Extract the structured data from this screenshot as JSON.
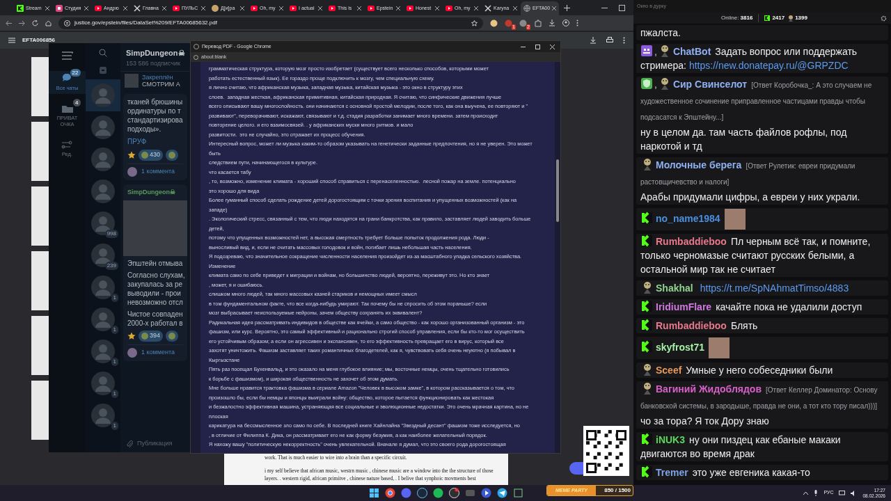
{
  "browser": {
    "tabs": [
      {
        "label": "Stream",
        "kind": "kick",
        "selected": false
      },
      {
        "label": "Студия",
        "kind": "studio",
        "selected": false
      },
      {
        "label": "Андрю",
        "kind": "youtube",
        "selected": false
      },
      {
        "label": "Главна",
        "kind": "x",
        "selected": false
      },
      {
        "label": "ПУЛЬС",
        "kind": "youtube",
        "selected": false
      },
      {
        "label": "Д[и]ра",
        "kind": "avatar",
        "selected": false
      },
      {
        "label": "Oh, my",
        "kind": "youtube",
        "selected": false
      },
      {
        "label": "I actual",
        "kind": "youtube",
        "selected": false
      },
      {
        "label": "This is",
        "kind": "youtube",
        "selected": false
      },
      {
        "label": "Epstein",
        "kind": "youtube",
        "selected": false
      },
      {
        "label": "Honest",
        "kind": "youtube",
        "selected": false
      },
      {
        "label": "Oh, my",
        "kind": "youtube",
        "selected": false
      },
      {
        "label": "Karyna",
        "kind": "x",
        "selected": false
      },
      {
        "label": "EFTA00",
        "kind": "globe",
        "selected": true
      }
    ],
    "url": "justice.gov/epstein/files/DataSet%209/EFTA00685632.pdf",
    "extensions": [
      {
        "kind": "coin"
      },
      {
        "kind": "red",
        "badge": "1"
      },
      {
        "kind": "box",
        "badge": "2"
      },
      {
        "kind": "puzzle"
      }
    ],
    "pdf_title": "EFTA006856",
    "pdf_page": [
      [
        "work. That is much easier to wire into a brain than a specific circuit."
      ],
      [
        "i my self  believe that african music, westrn music , chinese music  are a window into the the structure of those",
        "layers.  .   western rigid,  african primitve , chinese nature based, .    I belive that synphoic movments best"
      ]
    ]
  },
  "telegram": {
    "folders": [
      {
        "label": "Все чаты",
        "badge": "22",
        "kind": "chats",
        "selected": true
      },
      {
        "label": "ПРИВАТ ОЧКА",
        "badge": "4",
        "kind": "folder",
        "selected": false
      },
      {
        "label": "Ред.",
        "kind": "edit",
        "selected": false
      }
    ],
    "chats": [
      {
        "selected": true
      },
      {
        "selected": false
      },
      {
        "selected": false
      },
      {
        "selected": false
      },
      {
        "badge": "998",
        "selected": false
      },
      {
        "badge": "239",
        "selected": false
      },
      {
        "badge": "1",
        "selected": false
      },
      {
        "badge": "1",
        "selected": false
      },
      {
        "badge": "1",
        "selected": false
      },
      {
        "badge": "1",
        "selected": false
      },
      {
        "badge": "1",
        "selected": false
      }
    ],
    "channel": {
      "title": "SimpDungeon☠",
      "subscribers": "153 586 подписчик"
    },
    "pinned": {
      "label": "Закреплён",
      "text": "СМОТРИМ А"
    },
    "posts": [
      {
        "paragraphs": [
          [
            "тканей брюшины",
            "ординатуры по т",
            "стандартизирова",
            "подходы»."
          ]
        ],
        "link": "ПРУФ",
        "reactions": [
          {
            "kind": "star"
          },
          {
            "kind": "emoji",
            "count": "430"
          },
          {
            "kind": "emoji"
          }
        ],
        "comments": "1 коммента"
      },
      {
        "author": "SimpDungeon☠",
        "media": true,
        "paragraphs": [
          [
            "Эпштейн отмыва"
          ],
          [
            "Согласно слухам,",
            "закупалась за ре",
            "выводили - прои",
            "невозможно отсл"
          ],
          [
            "Чистое совпаден",
            "2000-х работал в"
          ]
        ],
        "reactions": [
          {
            "kind": "star"
          },
          {
            "kind": "emoji",
            "count": "394"
          },
          {
            "kind": "emoji"
          }
        ],
        "comments": "1 коммента"
      }
    ],
    "composer": {
      "placeholder": "Публикация"
    }
  },
  "translator": {
    "title": "Перевод PDF - Google Chrome",
    "url": "about:blank",
    "lines": [
      "грамматическая структура, которую мозг просто изобретает (существует всего несколько способов, которыми может",
      "работать естественный язык). Ее гораздо проще подключить к мозгу, чем специальную схему.",
      "я лично считаю, что африканская музыка, западная музыка, китайская музыка - это окно в структуру этих",
      "слоев.  западная жесткая, африканская примитивная, китайская природная. Я считаю, что синфические движения лучше",
      "всего описывают вашу многослойность. они начинаются с основной простой мелодии, после того, как она выучена, ее повторяют и \"",
      "развивают\", переворачивают, искажают, связывают и т.д. стадия разработки занимает много времени. затем происходит",
      "повторение целого. и его взаимосвязей. . у африканских муски много ритмов. и мало",
      "развитости.  это не случайно, это отражает их процесс обучения.",
      "Интересный вопрос, может ли музыка каким-то образом указывать на генетически заданные предпочтения, но я не уверен. Это может",
      "быть",
      "следствием пути, начинающегося в культуре.",
      "что касается табу",
      ", то, возможно, изменение климата - хороший способ справиться с перенаселенностью.  лесной пожар на земле. потенциально",
      "это хорошо для вида",
      "Более гуманный способ сделать рождение детей дорогостоящим с точки зрения воспитания и упущенных возможностей (как на",
      "западе)",
      ". Экологический стресс, связанный с тем, что люди находятся на грани банкротства, как правило, заставляет людей заводить больше",
      "детей,",
      "потому что упущенных возможностей нет, а высокая смертность требует больше попыток продолжения рода. Люди -",
      "выносливый вид, и, если не считать массовых голодовок и войн, погибает лишь небольшая часть населения.",
      "Я подозреваю, что значительное сокращение численности населения произойдет из-за масштабного упадка сельского хозяйства.",
      "Изменение",
      "климата само по себе приведет к миграции и войнам, но большинство людей, вероятно, переживут это. Но кто знает",
      ", может, я и ошибаюсь.",
      "слишком много людей, так много массовых казней стариков и немощных имеет смысл",
      "в том фундаментальном факте, что все когда-нибудь умирают. Так почему бы не спросить об этом пораньше? если",
      "мозг выбрасывает неиспользуемые нейроны, зачем обществу сохранять их эквивалент?",
      "Радикальная идея рассматривать индивидов в обществе как ячейки, а само общество - как хорошо организованный организм - это",
      "фашизм, или курс. Вероятно, это самый эффективный и рационально строгий способ управления, если бы кто-то мог осуществить",
      "его устойчивым образом; а если он агрессивен и экспансивен, то его эффективность превращает его в вирус, который все",
      "захотят уничтожить. Фашизм заставляет таких романтичных благодетелей, как я, чувствовать себя очень неуютно (я побывал в",
      "Кыргызстане",
      "Пять раз посещал Бухенвальд, и это оказало на меня глубокое влияние; мы, восточные немцы, очень тщательно готовились",
      "к борьбе с фашизмом), и широкая общественность не захочет об этом думать.",
      "Мне больше нравится трактовка фашизма в сериале Amazon \"Человек в высоком замке\", в котором рассказывается о том, что",
      "произошло бы, если бы немцы и японцы выиграли войну: общество, которое пытается функционировать как жестокая",
      "и безжалостно эффективная машина, устраняющая все социальные и эволюционные недостатки. Это очень мрачная картина, но не",
      "плоская",
      "карикатура на бессмысленное зло само по себе. В последней книге Хайнлайна \"Звездный десант\" фашизм тоже исследуется, но",
      ", в отличие от Филиппа К. Дика, он рассматривает его не как форму безумия, а как наиболее желательный порядок.",
      "Я нахожу вашу \"политическую некорректность\" очень увлекательной. Вначале я думал, что это своего рода дорогостоящая"
    ]
  },
  "chat": {
    "window_title": "Окно в дурку",
    "online_label": "Online:",
    "online": "3816",
    "followers": "2417",
    "mascots": "1399",
    "badge_separator": ",",
    "messages": [
      {
        "text": "пжалста."
      },
      {
        "badges": [
          {
            "kind": "bot"
          },
          {
            "kind": "mascot"
          }
        ],
        "name": "ChatBot",
        "color": "#8fb1f2",
        "text": "Задать вопрос или поддержать стримера:",
        "link": "https://new.donatepay.ru/@GRPZDC"
      },
      {
        "badges": [
          {
            "kind": "shield"
          },
          {
            "kind": "mascot"
          }
        ],
        "name": "Сир Свинселот",
        "color": "#8fb1f2",
        "reply": "[Ответ Коробочка_: А это случаем не художественное сочинение приправленное частицами правды чтобы подсасатся к Эпштейну...]",
        "text": "ну в целом да. там часть файлов рофлы, под наркотой и тд"
      },
      {
        "badges": [
          {
            "kind": "mascot"
          }
        ],
        "name": "Молочные берега",
        "color": "#8fb1f2",
        "reply": "[Ответ Рулетик: евреи придумали растовщичевство и налоги]",
        "text": "Арабы придумали цифры, а евреи у них украли."
      },
      {
        "badges": [
          {
            "kind": "kick"
          }
        ],
        "name": "no_name1984",
        "color": "#4a8fe0",
        "emote": true
      },
      {
        "badges": [
          {
            "kind": "kick"
          }
        ],
        "name": "Rumbaddieboo",
        "color": "#e8788a",
        "text": "Пл черным всё так, и помните, только черномазые считают русских белыми, а остальной мир так не считает"
      },
      {
        "badges": [
          {
            "kind": "mascot"
          }
        ],
        "name": "Shakhal",
        "color": "#8fd48f",
        "link": "https://t.me/SpNAhmatTimso/4883"
      },
      {
        "badges": [
          {
            "kind": "kick"
          }
        ],
        "name": "IridiumFlare",
        "color": "#d078e0",
        "text": "качайте пока не удалили доступ"
      },
      {
        "badges": [
          {
            "kind": "kick"
          }
        ],
        "name": "Rumbaddieboo",
        "color": "#e8788a",
        "text": "Блять"
      },
      {
        "badges": [
          {
            "kind": "kick"
          }
        ],
        "name": "skyfrost71",
        "color": "#a8f0a8",
        "emote": true
      },
      {
        "badges": [
          {
            "kind": "mascot"
          }
        ],
        "name": "Sceef",
        "color": "#e8985a",
        "text": "Умные у него собеседники были"
      },
      {
        "badges": [
          {
            "kind": "mascot"
          }
        ],
        "name": "Вагиний Жидоблядов",
        "color": "#d860c8",
        "reply": "[Ответ Келлер Доминатор: Основу банковской системы, в зародыше, правда не они, а тот кто тору писал)))]",
        "text": "чо за тора? Я ток Дору знаю"
      },
      {
        "badges": [
          {
            "kind": "kick"
          }
        ],
        "name": "iNUK3",
        "color": "#5ad85a",
        "text": "ну они пиздец как ебаные макаки двигаются во время драк"
      },
      {
        "badges": [
          {
            "kind": "kick"
          }
        ],
        "name": "Tremer",
        "color": "#7fa4e6",
        "text": "это уже евгеника какая-то"
      }
    ]
  },
  "widget": {
    "title": "MEME PARTY",
    "reading": "850 / 1500",
    "level": 0.57
  },
  "taskbar": {
    "apps": [
      {
        "kind": "start"
      },
      {
        "kind": "chrome"
      },
      {
        "kind": "discord"
      },
      {
        "kind": "steam"
      },
      {
        "kind": "spotify"
      },
      {
        "kind": "obs"
      },
      {
        "kind": "media"
      },
      {
        "kind": "player"
      },
      {
        "kind": "telegram"
      },
      {
        "kind": "snip"
      }
    ],
    "language": "РУС",
    "time": "17:27",
    "date": "08.02.2026"
  }
}
